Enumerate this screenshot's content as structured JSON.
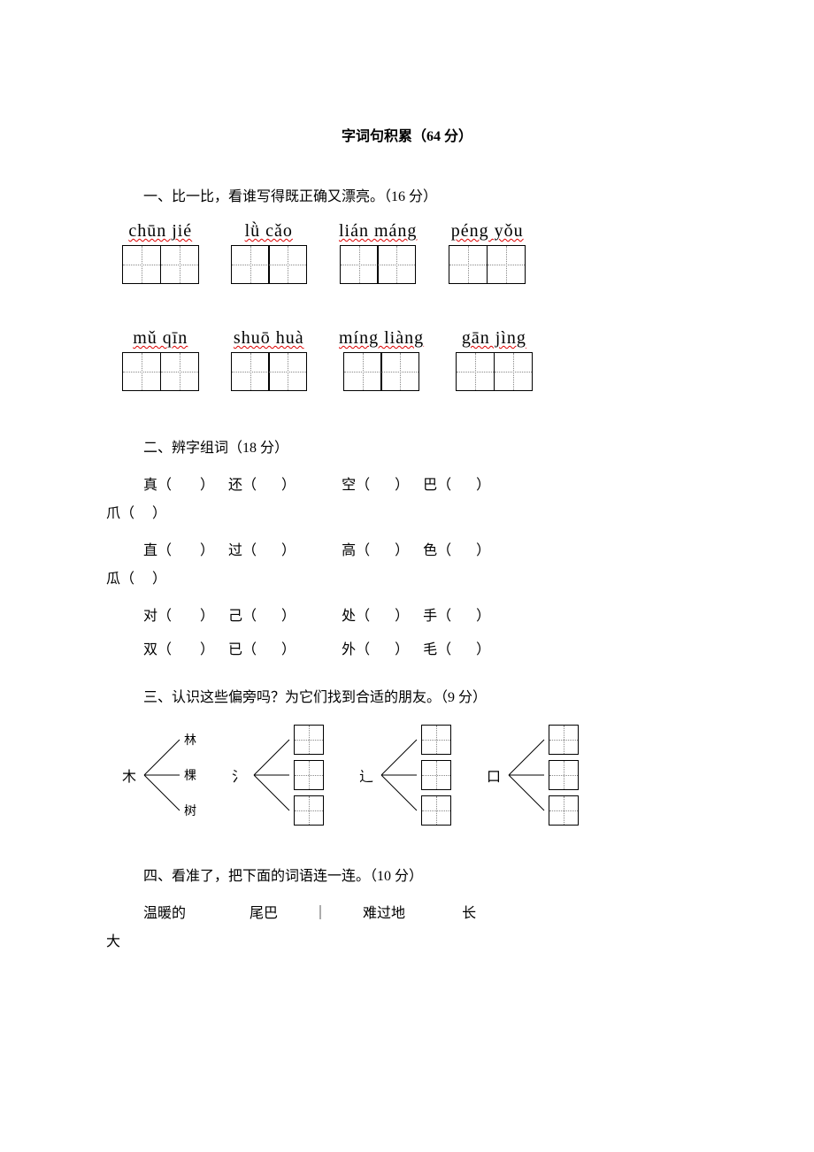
{
  "title": "字词句积累（64 分）",
  "section1": {
    "heading": "一、比一比，看谁写得既正确又漂亮。（16 分）",
    "row1": [
      {
        "pinyin": "chūn  jié"
      },
      {
        "pinyin": "lǜ   cǎo"
      },
      {
        "pinyin": "lián máng"
      },
      {
        "pinyin": "péng yǒu"
      }
    ],
    "row2": [
      {
        "pinyin": "mǔ   qīn"
      },
      {
        "pinyin": "shuō huà"
      },
      {
        "pinyin": "míng liàng"
      },
      {
        "pinyin": "gān jìng"
      }
    ]
  },
  "section2": {
    "heading": "二、辨字组词（18 分）",
    "rows": [
      [
        {
          "char": "真",
          "blank": "（        ）"
        },
        {
          "char": "还",
          "blank": "（       ）"
        },
        {
          "char": "空",
          "blank": "（       ）"
        },
        {
          "char": "巴",
          "blank": "（       ）"
        }
      ],
      [
        {
          "char": "爪",
          "blank": "（     ）",
          "wrap": true
        }
      ],
      [
        {
          "char": "直",
          "blank": "（        ）"
        },
        {
          "char": "过",
          "blank": "（       ）"
        },
        {
          "char": "高",
          "blank": "（       ）"
        },
        {
          "char": "色",
          "blank": "（       ）"
        }
      ],
      [
        {
          "char": "瓜",
          "blank": "（     ）",
          "wrap": true
        }
      ],
      [
        {
          "char": "对",
          "blank": "（        ）"
        },
        {
          "char": "己",
          "blank": "（       ）"
        },
        {
          "char": "处",
          "blank": "（       ）"
        },
        {
          "char": "手",
          "blank": "（       ）"
        }
      ],
      [
        {
          "char": "双",
          "blank": "（        ）"
        },
        {
          "char": "已",
          "blank": "（       ）"
        },
        {
          "char": "外",
          "blank": "（       ）"
        },
        {
          "char": "毛",
          "blank": "（       ）"
        }
      ]
    ]
  },
  "section3": {
    "heading": "三、认识这些偏旁吗？为它们找到合适的朋友。（9 分）",
    "groups": [
      {
        "radical": "木",
        "examples": [
          "林",
          "棵",
          "树"
        ],
        "show_examples": true
      },
      {
        "radical": "氵",
        "examples": [
          "",
          "",
          ""
        ],
        "show_examples": false
      },
      {
        "radical": "辶",
        "examples": [
          "",
          "",
          ""
        ],
        "show_examples": false
      },
      {
        "radical": "口",
        "examples": [
          "",
          "",
          ""
        ],
        "show_examples": false
      }
    ]
  },
  "section4": {
    "heading": "四、看准了，把下面的词语连一连。（10 分）",
    "left_pairs": [
      {
        "a": "温暖的",
        "b": "尾巴"
      }
    ],
    "right_pairs": [
      {
        "a": "难过地",
        "b": "长"
      }
    ],
    "wrap_tail": "大"
  }
}
